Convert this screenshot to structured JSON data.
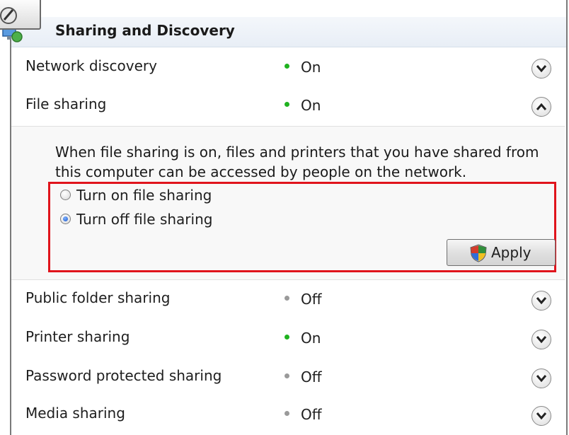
{
  "section": {
    "title": "Sharing and Discovery"
  },
  "colors": {
    "on": "#1fb21f",
    "off": "#9a9a9a",
    "highlight": "#e0141c"
  },
  "rows_top": [
    {
      "label": "Network discovery",
      "status": "On",
      "chevron": "chevron-down-icon"
    },
    {
      "label": "File sharing",
      "status": "On",
      "chevron": "chevron-up-icon"
    }
  ],
  "file_sharing_panel": {
    "description": "When file sharing is on, files and printers that you have shared from this computer can be accessed by people on the network.",
    "options": [
      {
        "label": "Turn on file sharing",
        "selected": false
      },
      {
        "label": "Turn off file sharing",
        "selected": true
      }
    ],
    "apply_label": "Apply",
    "apply_icon": "uac-shield-icon"
  },
  "rows_bottom": [
    {
      "label": "Public folder sharing",
      "status": "Off",
      "chevron": "chevron-down-icon"
    },
    {
      "label": "Printer sharing",
      "status": "On",
      "chevron": "chevron-down-icon"
    },
    {
      "label": "Password protected sharing",
      "status": "Off",
      "chevron": "chevron-down-icon"
    },
    {
      "label": "Media sharing",
      "status": "Off",
      "chevron": "chevron-down-icon"
    }
  ]
}
